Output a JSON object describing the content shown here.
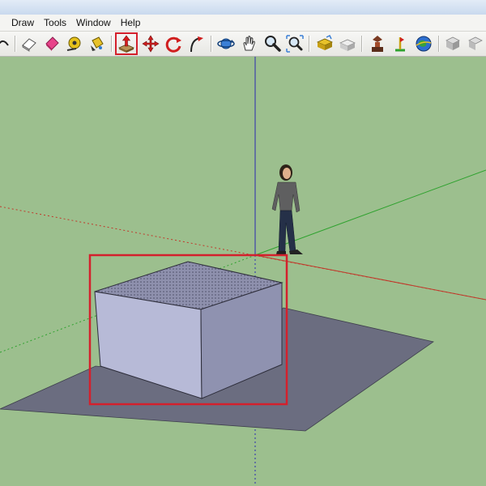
{
  "menu": {
    "items": [
      {
        "label": "Draw"
      },
      {
        "label": "Tools"
      },
      {
        "label": "Window"
      },
      {
        "label": "Help"
      }
    ]
  },
  "toolbar": {
    "tools": [
      {
        "name": "arc-tool",
        "icon": "arc-icon"
      },
      {
        "name": "eraser-tool",
        "icon": "eraser-icon"
      },
      {
        "name": "paint-bucket-tool",
        "icon": "paint-bucket-icon"
      },
      {
        "name": "tape-measure-tool",
        "icon": "tape-measure-icon"
      },
      {
        "name": "paint-tool",
        "icon": "paint-icon"
      },
      {
        "name": "push-pull-tool",
        "icon": "push-pull-icon",
        "active": true
      },
      {
        "name": "move-tool",
        "icon": "move-icon"
      },
      {
        "name": "rotate-tool",
        "icon": "rotate-icon"
      },
      {
        "name": "follow-me-tool",
        "icon": "follow-me-icon"
      },
      {
        "name": "orbit-tool",
        "icon": "orbit-icon"
      },
      {
        "name": "pan-tool",
        "icon": "pan-hand-icon"
      },
      {
        "name": "zoom-tool",
        "icon": "zoom-icon"
      },
      {
        "name": "zoom-extents-tool",
        "icon": "zoom-extents-icon"
      },
      {
        "name": "warehouse-tool",
        "icon": "3d-warehouse-icon"
      },
      {
        "name": "share-model-tool",
        "icon": "share-model-icon"
      },
      {
        "name": "components-tool",
        "icon": "components-icon"
      },
      {
        "name": "geo-location-tool",
        "icon": "geo-location-icon"
      },
      {
        "name": "google-earth-tool",
        "icon": "google-earth-icon"
      },
      {
        "name": "section-tool",
        "icon": "section-plane-icon"
      }
    ]
  },
  "colors": {
    "ground": "#9cbf8e",
    "box_top": "#8e90ad",
    "box_front": "#b7bad7",
    "box_side": "#8f92b0",
    "shadow": "#6b6d80",
    "highlight": "#d4202c",
    "axis_red": "#c0392b",
    "axis_green": "#2fa22f",
    "axis_blue": "#2a2ab0"
  }
}
